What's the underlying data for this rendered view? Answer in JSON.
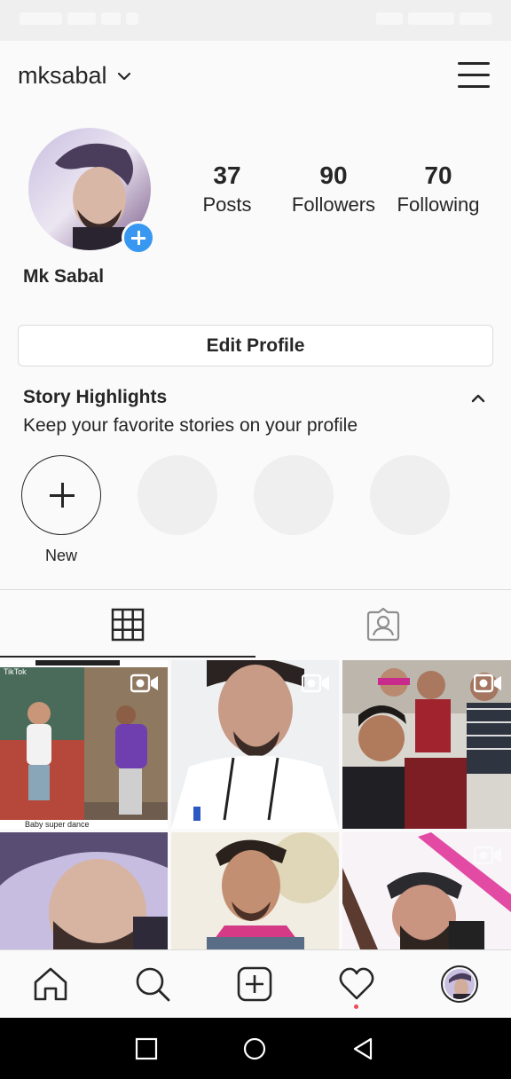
{
  "header": {
    "username": "mksabal"
  },
  "profile": {
    "full_name": "Mk Sabal",
    "stats": [
      {
        "value": "37",
        "label": "Posts"
      },
      {
        "value": "90",
        "label": "Followers"
      },
      {
        "value": "70",
        "label": "Following"
      }
    ],
    "edit_button": "Edit Profile"
  },
  "highlights": {
    "title": "Story Highlights",
    "subtitle": "Keep your favorite stories on your profile",
    "new_label": "New"
  },
  "posts": {
    "tile1_brand": "TikTok",
    "tile1_caption": "Baby super dance"
  },
  "colors": {
    "accent": "#3897f0",
    "notification": "#ed4956",
    "text": "#262626"
  },
  "icons": {
    "username_menu": "chevron-down-icon",
    "header_menu": "hamburger-menu-icon",
    "add_story": "plus-icon",
    "highlights_toggle": "chevron-up-icon",
    "tab_grid": "grid-icon",
    "tab_tagged": "tagged-user-icon",
    "video_indicator": "video-icon",
    "nav": [
      "home-icon",
      "search-icon",
      "add-post-icon",
      "heart-icon",
      "profile-avatar"
    ],
    "system_nav": [
      "recents-square-icon",
      "home-circle-icon",
      "back-triangle-icon"
    ]
  }
}
